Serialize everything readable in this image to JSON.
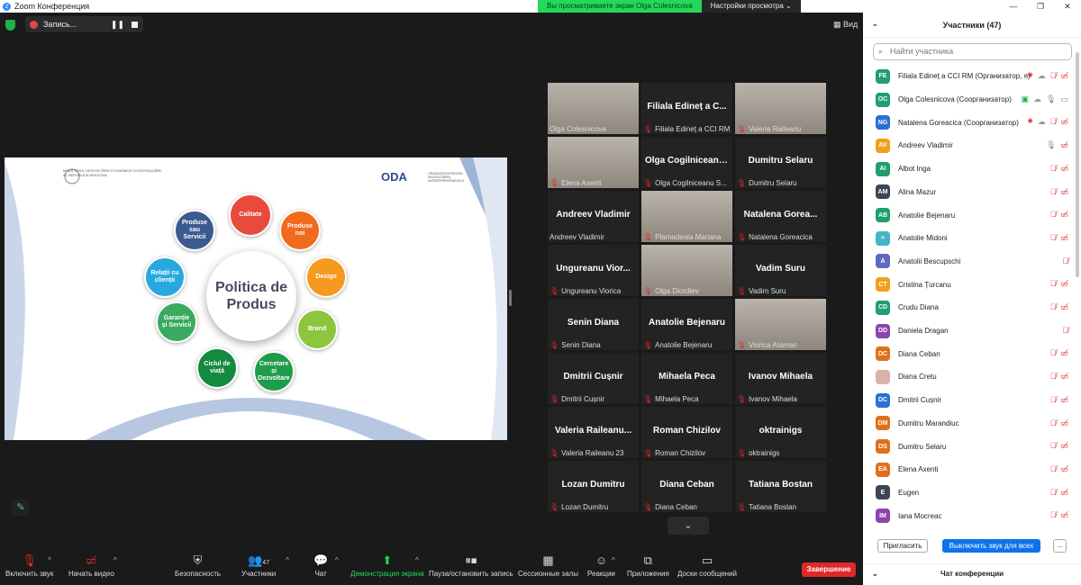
{
  "window": {
    "title": "Zoom Конференция",
    "app_icon": "zoom-icon",
    "controls": [
      "—",
      "❐",
      "✕"
    ]
  },
  "share_banner": {
    "message": "Вы просматриваете экран Olga Colesnicova",
    "options": "Настройки просмотра"
  },
  "recording": {
    "label": "Запись..."
  },
  "view_button": {
    "label": "Вид"
  },
  "slide": {
    "center": "Politica de Produs",
    "ministry": "MINISTERUL DEZVOLTĂRII ECONOMICE ȘI DIGITALIZĂRII AL REPUBLICII MOLDOVA",
    "oda": "ODA",
    "oda_sub": "ORGANIZAȚIA PENTRU DEZVOLTAREA ANTREPRENORIATULUI",
    "bubbles": [
      {
        "text": "Calitate",
        "color": "#e84b3c"
      },
      {
        "text": "Produse noi",
        "color": "#f06b1b"
      },
      {
        "text": "Design",
        "color": "#f59a1f"
      },
      {
        "text": "Brand",
        "color": "#8cc63e"
      },
      {
        "text": "Cercetare și Dezvoltare",
        "color": "#1e9c4a"
      },
      {
        "text": "Ciclul de viață",
        "color": "#148a40"
      },
      {
        "text": "Garanție și Servicii",
        "color": "#3aaa5e"
      },
      {
        "text": "Relații cu clienții",
        "color": "#27a9e0"
      },
      {
        "text": "Produse sau Servicii",
        "color": "#3b5b8f"
      }
    ]
  },
  "gallery": [
    {
      "name": "",
      "label": "Olga Colesnicova",
      "video": true,
      "active": true,
      "muted": false
    },
    {
      "name": "Filiala Edineț a C...",
      "label": "Filiala Edineț a CCI RM",
      "video": false,
      "muted": true
    },
    {
      "name": "",
      "label": "Valeria Raileanu",
      "video": true,
      "muted": true
    },
    {
      "name": "",
      "label": "Elena Axenti",
      "video": true,
      "muted": true
    },
    {
      "name": "Olga Cogilniceanu ...",
      "label": "Olga Cogilniceanu S...",
      "video": false,
      "muted": true
    },
    {
      "name": "Dumitru Selaru",
      "label": "Dumitru Selaru",
      "video": false,
      "muted": true
    },
    {
      "name": "Andreev Vladimir",
      "label": "Andreev Vladimir",
      "video": false,
      "muted": false
    },
    {
      "name": "",
      "label": "Plamadeala Mariana",
      "video": true,
      "muted": true
    },
    {
      "name": "Natalena Gorea...",
      "label": "Natalena Goreacica",
      "video": false,
      "muted": true
    },
    {
      "name": "Ungureanu Vior...",
      "label": "Ungureanu Viorica",
      "video": false,
      "muted": true
    },
    {
      "name": "",
      "label": "Olga Diordiev",
      "video": true,
      "muted": true
    },
    {
      "name": "Vadim Suru",
      "label": "Vadim Suru",
      "video": false,
      "muted": true
    },
    {
      "name": "Senin Diana",
      "label": "Senin Diana",
      "video": false,
      "muted": true
    },
    {
      "name": "Anatolie Bejenaru",
      "label": "Anatolie Bejenaru",
      "video": false,
      "muted": true
    },
    {
      "name": "",
      "label": "Viorica Ataman",
      "video": true,
      "muted": true
    },
    {
      "name": "Dmitrii Cușnir",
      "label": "Dmitrii Cușnir",
      "video": false,
      "muted": true
    },
    {
      "name": "Mihaela Peca",
      "label": "Mihaela Peca",
      "video": false,
      "muted": true
    },
    {
      "name": "Ivanov Mihaela",
      "label": "Ivanov Mihaela",
      "video": false,
      "muted": true
    },
    {
      "name": "Valeria Raileanu...",
      "label": "Valeria Raileanu 23",
      "video": false,
      "muted": true
    },
    {
      "name": "Roman Chizilov",
      "label": "Roman Chizilov",
      "video": false,
      "muted": true
    },
    {
      "name": "oktrainigs",
      "label": "oktrainigs",
      "video": false,
      "muted": true
    },
    {
      "name": "Lozan Dumitru",
      "label": "Lozan Dumitru",
      "video": false,
      "muted": true
    },
    {
      "name": "Diana Ceban",
      "label": "Diana Ceban",
      "video": false,
      "muted": true
    },
    {
      "name": "Tatiana Bostan",
      "label": "Tatiana Bostan",
      "video": false,
      "muted": true
    }
  ],
  "toolbar": {
    "unmute": "Включить звук",
    "start_video": "Начать видео",
    "security": "Безопасность",
    "participants": "Участники",
    "participants_count": "47",
    "chat": "Чат",
    "share": "Демонстрация экрана",
    "pause_record": "Пауза/остановить запись",
    "breakout": "Сессионные залы",
    "reactions": "Реакции",
    "apps": "Приложения",
    "whiteboards": "Доски сообщений",
    "end": "Завершение"
  },
  "sidebar": {
    "title": "Участники (47)",
    "search_placeholder": "Найти участника",
    "participants": [
      {
        "initials": "FE",
        "color": "#1f9e6e",
        "name": "Filiala Edineț a CCI RM (Организатор, я)",
        "mic": "off",
        "vid": "off",
        "extra": "rec"
      },
      {
        "initials": "OC",
        "color": "#1f9e6e",
        "name": "Olga Colesnicova (Соорганизатор)",
        "mic": "on",
        "vid": "on",
        "extra": "share"
      },
      {
        "initials": "NG",
        "color": "#2a6fd6",
        "name": "Natalena Goreacica (Соорганизатор)",
        "mic": "off",
        "vid": "off",
        "extra": "rec"
      },
      {
        "initials": "AV",
        "color": "#f0a01a",
        "name": "Andreev Vladimir",
        "mic": "on",
        "vid": "off"
      },
      {
        "initials": "AI",
        "color": "#1f9e6e",
        "name": "Albot Inga",
        "mic": "off",
        "vid": "off"
      },
      {
        "initials": "AM",
        "color": "#3c4556",
        "name": "Alina Mazur",
        "mic": "off",
        "vid": "off"
      },
      {
        "initials": "AB",
        "color": "#1f9e6e",
        "name": "Anatolie Bejenaru",
        "mic": "off",
        "vid": "off"
      },
      {
        "initials": "≈",
        "color": "#45b6c9",
        "name": "Anatolie Midoni",
        "mic": "off",
        "vid": "off"
      },
      {
        "initials": "A",
        "color": "#5c6bc0",
        "name": "Anatolii Bescupschi",
        "mic": "off",
        "vid": "none"
      },
      {
        "initials": "CT",
        "color": "#f0a01a",
        "name": "Cristina Țurcanu",
        "mic": "off",
        "vid": "off"
      },
      {
        "initials": "CD",
        "color": "#1f9e6e",
        "name": "Crudu Diana",
        "mic": "off",
        "vid": "off"
      },
      {
        "initials": "DD",
        "color": "#8e44ad",
        "name": "Daniela Dragan",
        "mic": "off",
        "vid": "none"
      },
      {
        "initials": "DC",
        "color": "#e0701a",
        "name": "Diana Ceban",
        "mic": "off",
        "vid": "off"
      },
      {
        "initials": "",
        "color": "#d9b3a8",
        "name": "Diana Cretu",
        "mic": "off",
        "vid": "off"
      },
      {
        "initials": "DC",
        "color": "#2a6fd6",
        "name": "Dmitrii Cușnir",
        "mic": "off",
        "vid": "off"
      },
      {
        "initials": "DM",
        "color": "#e0701a",
        "name": "Dumitru Marandiuc",
        "mic": "off",
        "vid": "off"
      },
      {
        "initials": "DS",
        "color": "#e0701a",
        "name": "Dumitru Selaru",
        "mic": "off",
        "vid": "off"
      },
      {
        "initials": "EA",
        "color": "#e0701a",
        "name": "Elena Axenti",
        "mic": "off",
        "vid": "off"
      },
      {
        "initials": "E",
        "color": "#3c4556",
        "name": "Eugen",
        "mic": "off",
        "vid": "off"
      },
      {
        "initials": "IM",
        "color": "#8e44ad",
        "name": "Iana Mocreac",
        "mic": "off",
        "vid": "off"
      }
    ],
    "invite": "Пригласить",
    "mute_all": "Выключить звук для всех",
    "more": "...",
    "chat_title": "Чат конференции"
  }
}
